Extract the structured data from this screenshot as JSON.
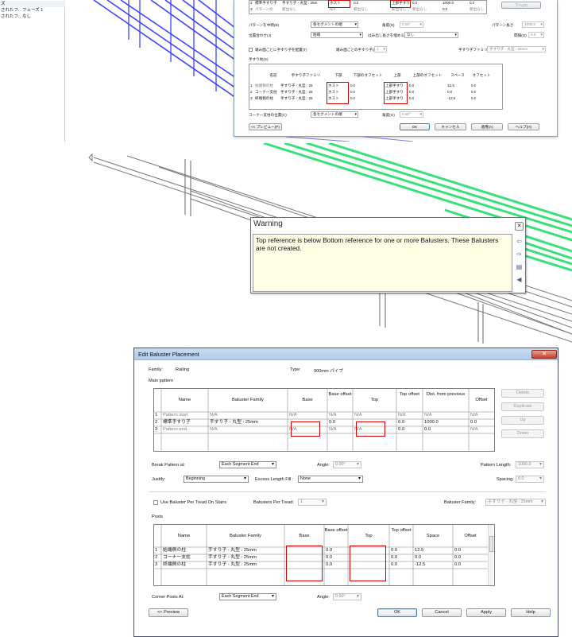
{
  "colors": {
    "highlight": "#d20000",
    "railing_blue": "#3a44ff",
    "railing_green": "#39e07a",
    "warning_bg": "#ffffe6"
  },
  "top_props": {
    "rows": [
      {
        "c1": "ズ",
        "c2": ""
      },
      {
        "c1": "されたフ...",
        "c2": "フェーズ 1"
      },
      {
        "c1": "されたフ...",
        "c2": "なし"
      }
    ]
  },
  "jp_dialog": {
    "rows": [
      {
        "num": "2",
        "c1": "標準手すり子",
        "c2": "手すり子 - 丸型 : 25m",
        "c3": "ホスト",
        "c4": "0.0",
        "c5": "上部手すり",
        "c6": "0.0",
        "c7": "1000.0",
        "c8": "0.0"
      },
      {
        "num": "3",
        "c1": "パターンの",
        "c2": "新出なし",
        "c3": "N/A",
        "c4": "新出なし",
        "c5": "新出なし",
        "c6": "新出なし",
        "c7": "0.0",
        "c8": "新出なし"
      }
    ],
    "down_btn": "下へ(O)",
    "pattern_break_label": "パターンを中断(B)",
    "pattern_break_value": "各セグメントの端",
    "angle_label": "角度(N)",
    "angle_value": "0.00°",
    "pattern_length_label": "パターン長さ",
    "pattern_length_value": "1000.0",
    "justify_label": "位置合わせ(J)",
    "justify_value": "始端",
    "excess_label": "はみ出し長さを埋める(E)",
    "excess_value": "なし",
    "spacing_label": "間隔(G)",
    "spacing_value": "0.0",
    "tread_label": "踏み面ごとに手すり子を配置(T)",
    "per_tread_label": "踏み面ごとの手すり子(R)",
    "per_tread_value": "1",
    "family_label": "手すり子ファミリ(F)",
    "family_value": "手すり子 - 丸型 : 25mm",
    "posts_label": "手すり柱(S)",
    "headers": [
      "名前",
      "手すり子ファミリ",
      "下部",
      "下部のオフセット",
      "上部",
      "上部のオフセット",
      "スペース",
      "オフセット"
    ],
    "posts": [
      {
        "num": "1",
        "name": "始端側の柱",
        "family": "手すり子 - 丸型 : 25",
        "base": "ホスト",
        "boff": "0.0",
        "top": "上部手すり",
        "toff": "0.0",
        "space": "12.5",
        "off": "0.0"
      },
      {
        "num": "2",
        "name": "コーナー支柱",
        "family": "手すり子 - 丸型 : 25",
        "base": "ホスト",
        "boff": "0.0",
        "top": "上部手すり",
        "toff": "0.0",
        "space": "0.0",
        "off": "0.0"
      },
      {
        "num": "3",
        "name": "終端側の柱",
        "family": "手すり子 - 丸型 : 25",
        "base": "ホスト",
        "boff": "0.0",
        "top": "上部手すり",
        "toff": "0.0",
        "space": "-12.5",
        "off": "0.0"
      }
    ],
    "corner_label": "コーナー支柱の位置(C)",
    "corner_value": "各セグメントの端",
    "corner_angle_label": "角度(G)",
    "corner_angle_value": "0.00°",
    "preview_btn": "<< プレビュー(P)",
    "ok_btn": "OK",
    "cancel_btn": "キャンセル",
    "apply_btn": "適用(A)",
    "help_btn": "ヘルプ(H)"
  },
  "warning": {
    "title": "Warning",
    "message": "Top reference is below Bottom reference for one or more Balusters. These Balusters are not created."
  },
  "dialog": {
    "title": "Edit Baluster Placement",
    "family_label": "Family:",
    "family_value": "Railing",
    "type_label": "Type:",
    "type_value": "900mm パイプ",
    "main_pattern_label": "Main pattern",
    "main_headers": [
      "Name",
      "Baluster Family",
      "Base",
      "Base offset",
      "Top",
      "Top offset",
      "Dist. from previous",
      "Offset"
    ],
    "main_rows": [
      {
        "num": "1",
        "name": "Pattern start",
        "family": "N/A",
        "base": "N/A",
        "boff": "N/A",
        "top": "N/A",
        "toff": "N/A",
        "dist": "N/A",
        "off": "N/A"
      },
      {
        "num": "2",
        "name": "標準手すり子",
        "family": "手すり子 - 丸型 : 25mm",
        "base": "",
        "boff": "0.0",
        "top": "",
        "toff": "0.0",
        "dist": "1000.0",
        "off": "0.0"
      },
      {
        "num": "3",
        "name": "Pattern end",
        "family": "N/A",
        "base": "N/A",
        "boff": "N/A",
        "top": "N/A",
        "toff": "0.0",
        "dist": "0.0",
        "off": "N/A"
      }
    ],
    "side_buttons": [
      "Delete",
      "Duplicate",
      "Up",
      "Down"
    ],
    "break_label": "Break Pattern at:",
    "break_value": "Each Segment End",
    "angle_label": "Angle:",
    "angle_value": "0.00°",
    "pattern_length_label": "Pattern Length:",
    "pattern_length_value": "1000.0",
    "justify_label": "Justify:",
    "justify_value": "Beginning",
    "excess_label": "Excess Length Fill :",
    "excess_value": "None",
    "spacing_label": "Spacing:",
    "spacing_value": "0.0",
    "per_tread_check": "Use Baluster Per Tread On Stairs",
    "per_tread_label": "Balusters Per Tread:",
    "per_tread_value": "1",
    "baluster_family_label": "Baluster Family:",
    "baluster_family_value": "手すり子 - 丸型 : 25mm",
    "posts_label": "Posts",
    "post_headers": [
      "Name",
      "Baluster Family",
      "Base",
      "Base offset",
      "Top",
      "Top offset",
      "Space",
      "Offset"
    ],
    "post_rows": [
      {
        "num": "1",
        "name": "始端側の柱",
        "family": "手すり子 - 丸型 : 25mm",
        "base": "",
        "boff": "0.0",
        "top": "",
        "toff": "0.0",
        "space": "12.5",
        "off": "0.0"
      },
      {
        "num": "2",
        "name": "コーナー支柱",
        "family": "手すり子 - 丸型 : 25mm",
        "base": "",
        "boff": "0.0",
        "top": "",
        "toff": "0.0",
        "space": "0.0",
        "off": "0.0"
      },
      {
        "num": "3",
        "name": "終端側の柱",
        "family": "手すり子 - 丸型 : 25mm",
        "base": "",
        "boff": "0.0",
        "top": "",
        "toff": "0.0",
        "space": "-12.5",
        "off": "0.0"
      }
    ],
    "corner_label": "Corner Posts At:",
    "corner_value": "Each Segment End",
    "corner_angle_label": "Angle:",
    "corner_angle_value": "0.00°",
    "preview_btn": "<< Preview",
    "ok_btn": "OK",
    "cancel_btn": "Cancel",
    "apply_btn": "Apply",
    "help_btn": "Help"
  }
}
